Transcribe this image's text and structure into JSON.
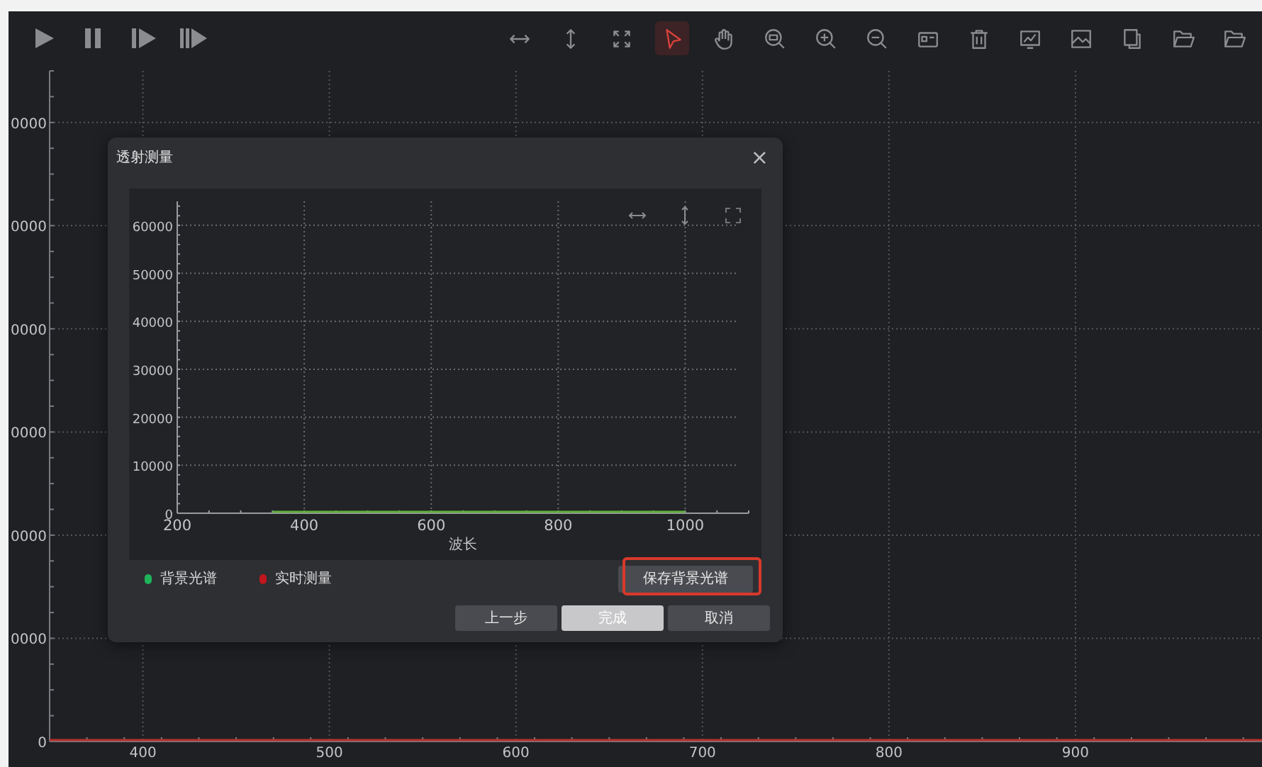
{
  "toolbar": {
    "tools": [
      {
        "selected": false
      },
      {
        "selected": false
      },
      {
        "selected": false
      },
      {
        "selected": true
      },
      {
        "selected": false
      },
      {
        "selected": false
      },
      {
        "selected": false
      },
      {
        "selected": false
      },
      {
        "selected": false
      },
      {
        "selected": false
      },
      {
        "selected": false
      },
      {
        "selected": false
      },
      {
        "selected": false
      },
      {
        "selected": false
      },
      {
        "selected": false
      }
    ]
  },
  "main_chart": {
    "y_axis_labels": [
      "0000",
      "0000",
      "0000",
      "0000",
      "0000",
      "0000",
      "0"
    ],
    "x_axis_labels": [
      "400",
      "500",
      "600",
      "700",
      "800",
      "900"
    ]
  },
  "dialog": {
    "title": "透射测量",
    "close": "×",
    "chart": {
      "chart_data": {
        "type": "line",
        "grid": true,
        "xlabel": "波长",
        "x": [
          350,
          1000
        ],
        "xlim": [
          200,
          1100
        ],
        "ylim": [
          0,
          65000
        ],
        "xticks": [
          200,
          400,
          600,
          800,
          1000
        ],
        "yticks": [
          0,
          10000,
          20000,
          30000,
          40000,
          50000,
          60000
        ],
        "series": [
          {
            "color": "#5fae3c",
            "values": [
              0,
              0
            ]
          }
        ]
      }
    },
    "legend": [
      {
        "label": "背景光谱",
        "color": "#1fb35a"
      },
      {
        "label": "实时测量",
        "color": "#c0161c"
      }
    ],
    "save_button": {
      "label": "保存背景光谱",
      "highlighted": true
    },
    "buttons": [
      {
        "label": "上一步",
        "kind": "normal"
      },
      {
        "label": "完成",
        "kind": "primary"
      },
      {
        "label": "取消",
        "kind": "normal"
      }
    ]
  }
}
